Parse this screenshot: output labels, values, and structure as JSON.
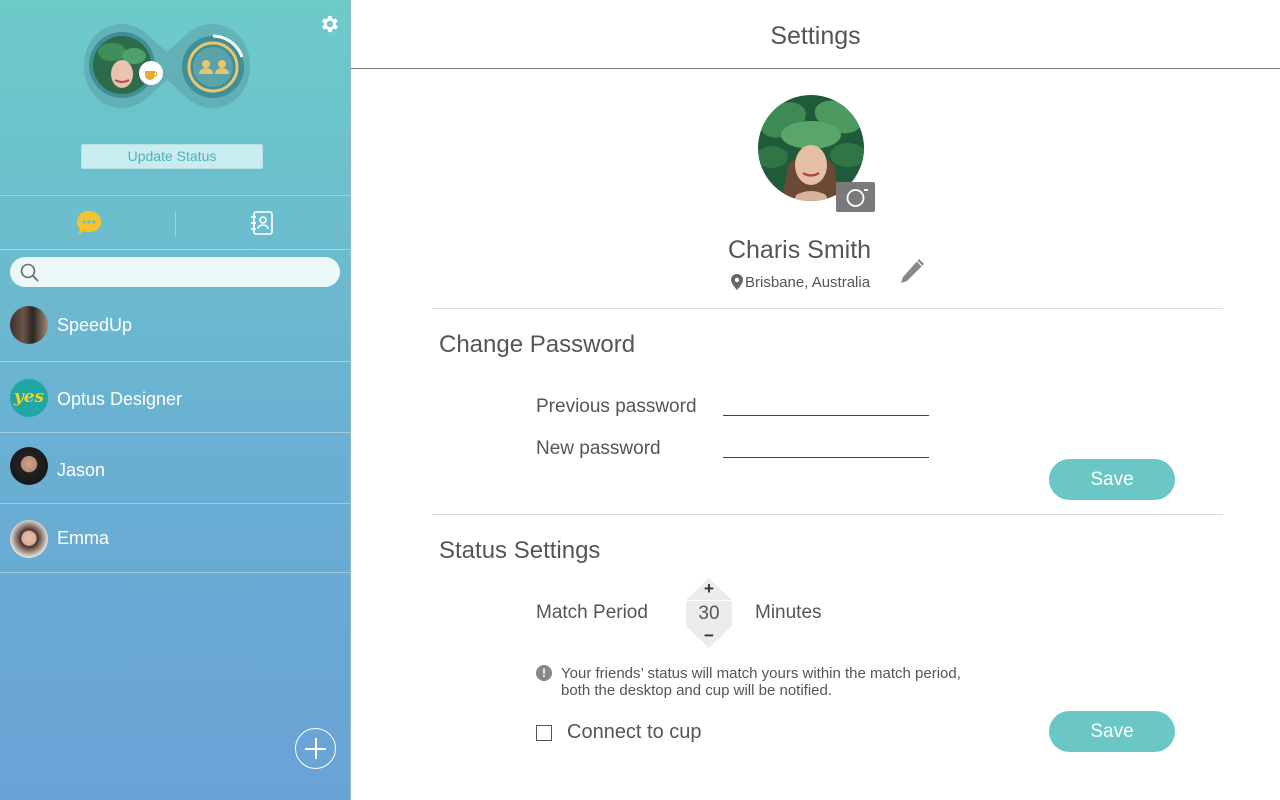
{
  "sidebar": {
    "update_status_label": "Update Status",
    "search": {
      "placeholder": "",
      "value": ""
    },
    "contacts": [
      {
        "name": "SpeedUp"
      },
      {
        "name": "Optus Designer",
        "avatar_text": "yes"
      },
      {
        "name": "Jason"
      },
      {
        "name": "Emma"
      }
    ],
    "icons": {
      "settings": "gear-icon",
      "chat_tab": "chat-bubble-icon",
      "contacts_tab": "address-book-icon",
      "search": "search-icon",
      "add": "plus-circle-icon",
      "status_badge": "coffee-cup-icon",
      "connected_friends": "people-icon"
    }
  },
  "main": {
    "title": "Settings",
    "profile": {
      "name": "Charis Smith",
      "location": "Brisbane, Australia"
    },
    "change_password": {
      "title": "Change Password",
      "previous_label": "Previous password",
      "new_label": "New password",
      "previous_value": "",
      "new_value": "",
      "save_label": "Save"
    },
    "status_settings": {
      "title": "Status Settings",
      "match_period_label": "Match Period",
      "match_period_value": "30",
      "stepper_plus": "+",
      "stepper_minus": "−",
      "unit_label": "Minutes",
      "info_symbol": "!",
      "info_line1": "Your friends’ status will match yours within the match period,",
      "info_line2": "both the desktop and cup will be notified.",
      "connect_label": "Connect to cup",
      "connect_checked": false,
      "save_label": "Save"
    }
  },
  "colors": {
    "accent": "#6ac7c5",
    "sidebar_top": "#6dcbc9",
    "sidebar_bottom": "#6aa2d6",
    "chat_icon": "#f5c32c"
  }
}
